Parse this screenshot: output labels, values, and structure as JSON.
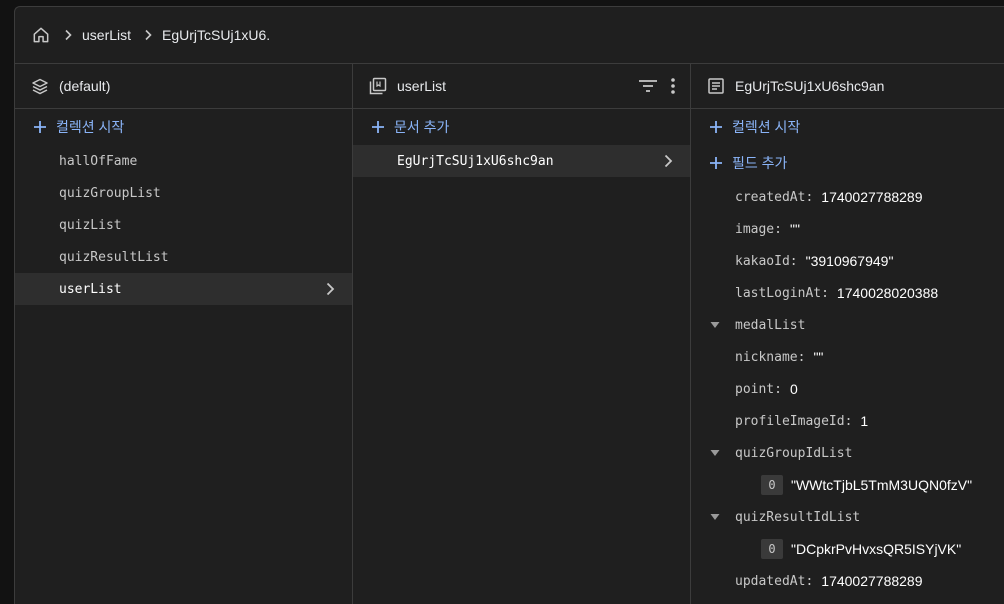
{
  "breadcrumb": {
    "home_icon": "home-icon",
    "items": [
      "userList",
      "EgUrjTcSUj1xU6."
    ]
  },
  "col1": {
    "header": "(default)",
    "header_icon": "database-stack-icon",
    "add_label": "컬렉션 시작",
    "collections": [
      "hallOfFame",
      "quizGroupList",
      "quizList",
      "quizResultList",
      "userList"
    ],
    "selected": "userList"
  },
  "col2": {
    "header": "userList",
    "header_icon": "collection-icon",
    "add_label": "문서 추가",
    "documents": [
      "EgUrjTcSUj1xU6shc9an"
    ]
  },
  "col3": {
    "header": "EgUrjTcSUj1xU6shc9an",
    "header_icon": "document-icon",
    "add_collection_label": "컬렉션 시작",
    "add_field_label": "필드 추가",
    "fields": {
      "createdAt": {
        "key": "createdAt",
        "value": "1740027788289"
      },
      "image": {
        "key": "image",
        "value": "\"\""
      },
      "kakaoId": {
        "key": "kakaoId",
        "value": "\"3910967949\""
      },
      "lastLoginAt": {
        "key": "lastLoginAt",
        "value": "1740028020388"
      },
      "medalList": {
        "key": "medalList"
      },
      "nickname": {
        "key": "nickname",
        "value": "\"\""
      },
      "point": {
        "key": "point",
        "value": "0"
      },
      "profileImageId": {
        "key": "profileImageId",
        "value": "1"
      },
      "quizGroupIdList": {
        "key": "quizGroupIdList",
        "items": [
          {
            "index": "0",
            "value": "\"WWtcTjbL5TmM3UQN0fzV\""
          }
        ]
      },
      "quizResultIdList": {
        "key": "quizResultIdList",
        "items": [
          {
            "index": "0",
            "value": "\"DCpkrPvHvxsQR5ISYjVK\""
          }
        ]
      },
      "updatedAt": {
        "key": "updatedAt",
        "value": "1740027788289"
      }
    }
  },
  "colors": {
    "accent": "#8ab4f8",
    "panel": "#1f1f1f",
    "selected_row": "#2e2e2e",
    "border": "#3c3c3c"
  }
}
